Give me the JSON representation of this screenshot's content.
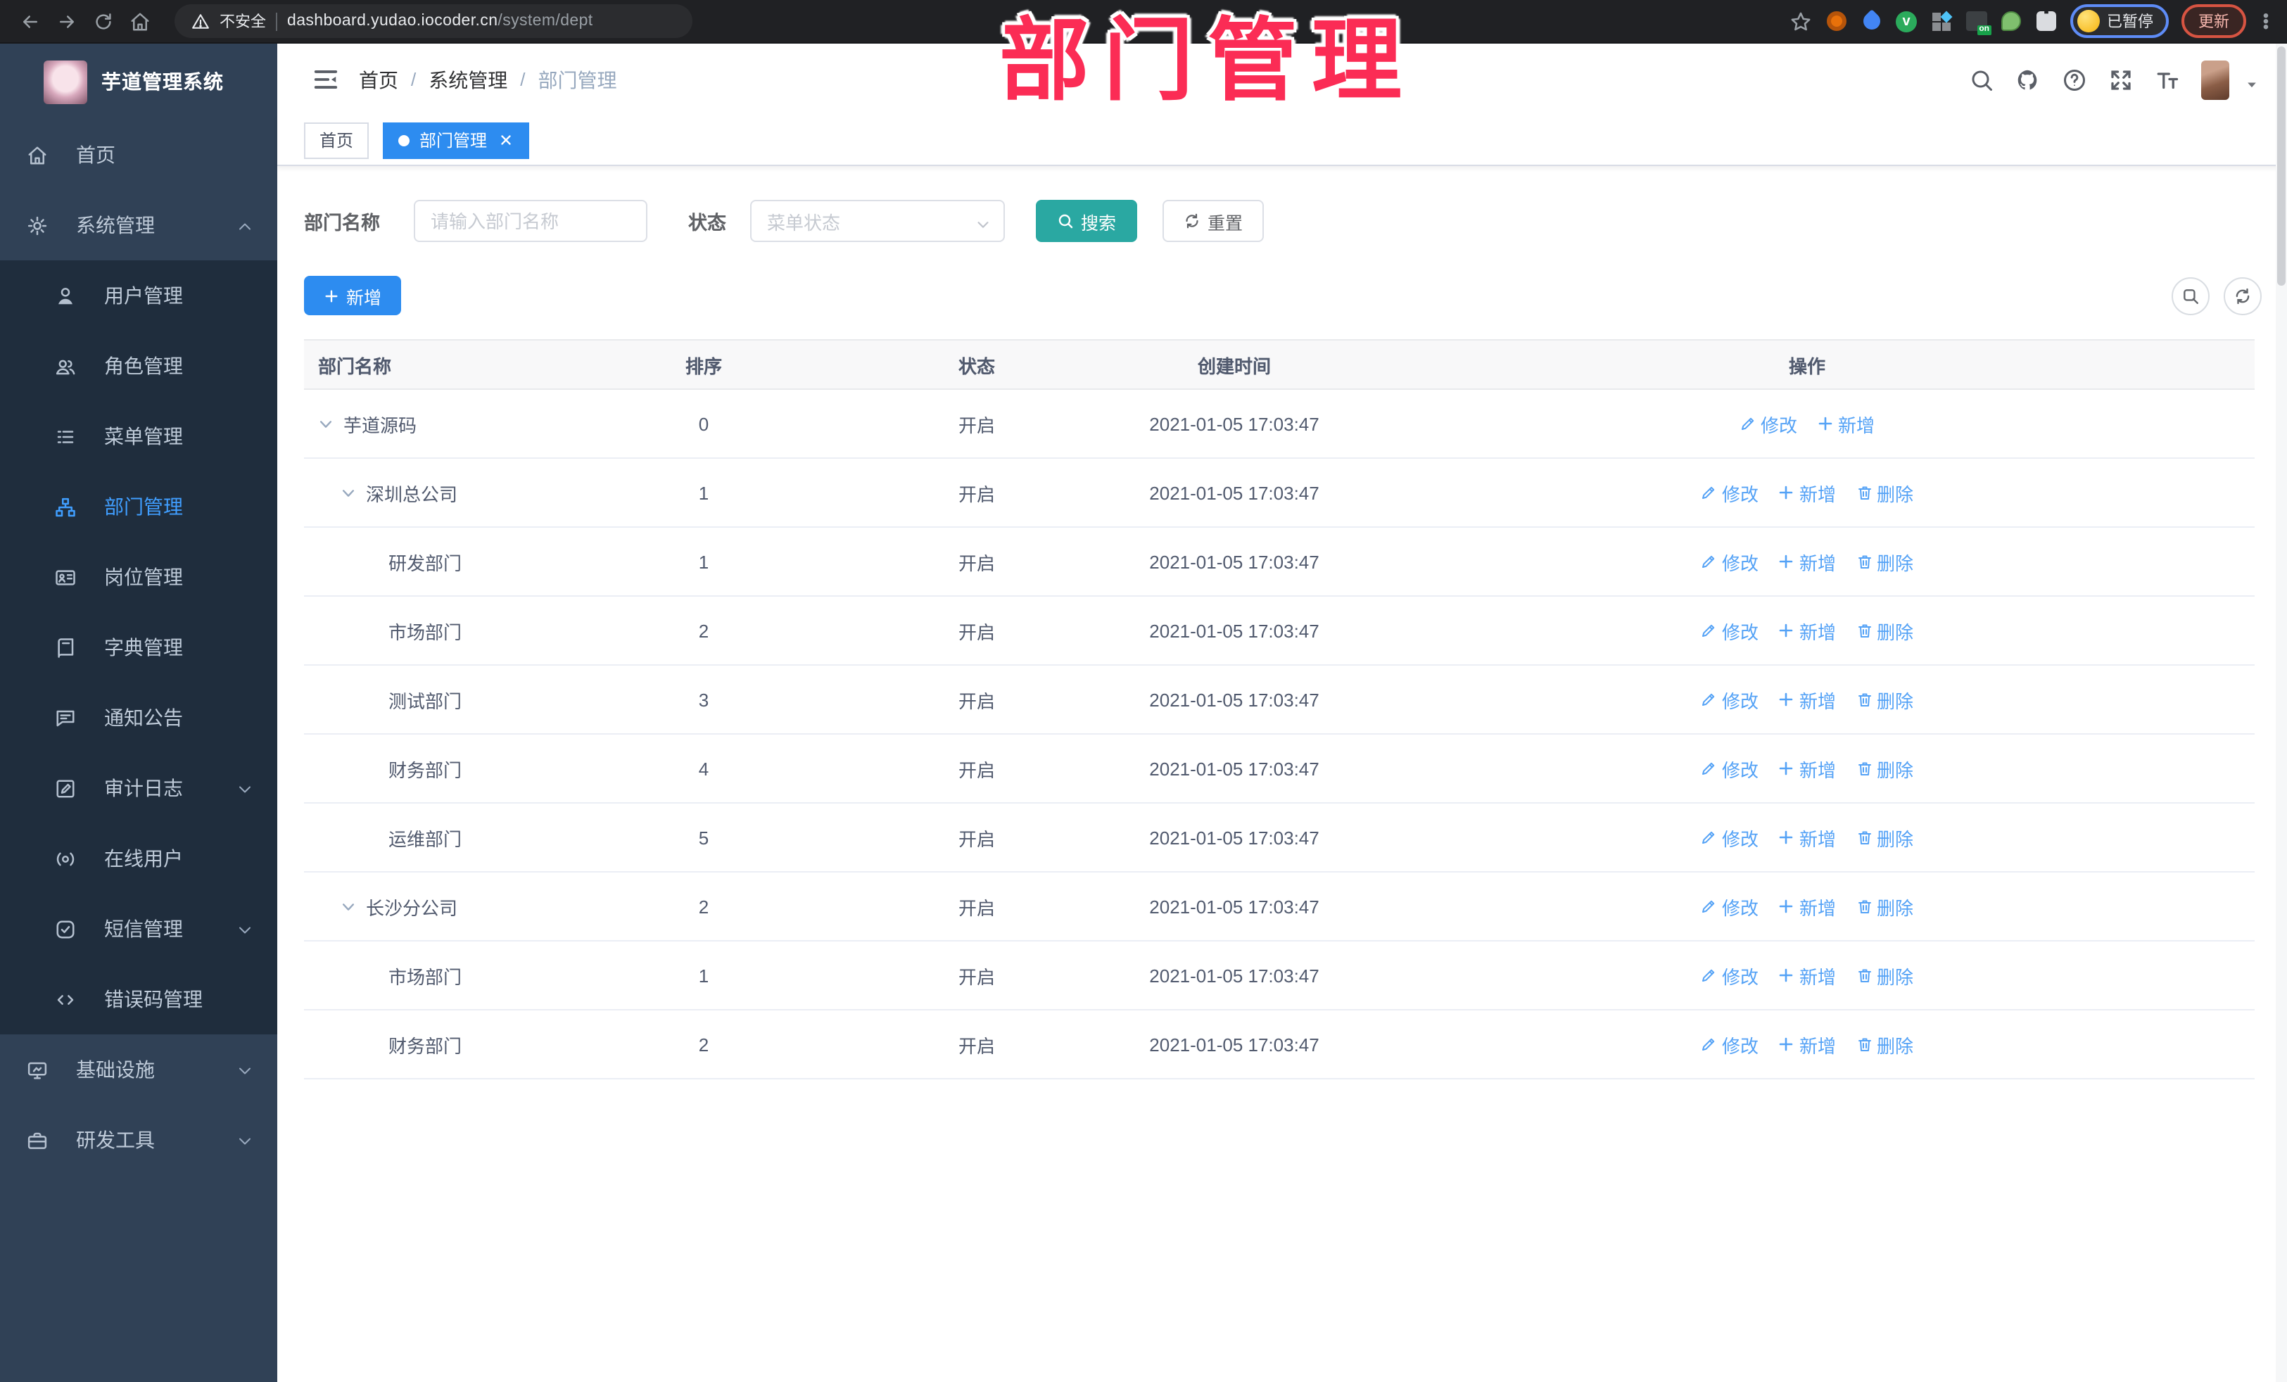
{
  "colors": {
    "accent_blue": "#2d8cf0",
    "sidebar_active_blue": "#409eff",
    "link_blue": "#54a2f6",
    "search_teal": "#2aa8a2",
    "overlay_pink": "#fb2c55",
    "sidebar_bg": "#304156",
    "submenu_bg": "#1f2d3d",
    "chrome_bg": "#202124"
  },
  "browser": {
    "nav_icons": [
      "back-icon",
      "forward-icon",
      "reload-icon",
      "home-icon"
    ],
    "security_label": "不安全",
    "url_host": "dashboard.yudao.iocoder.cn",
    "url_path": "/system/dept",
    "star_icon": "star-icon",
    "extension_icons": [
      "ext-orange-icon",
      "ext-blue-drop-icon",
      "ext-green-check-icon",
      "ext-grid-icon",
      "ext-dark-on-icon",
      "ext-green-leaf-icon",
      "ext-puzzle-icon"
    ],
    "ext_badge": "on",
    "ext_check": "v",
    "profile_badge": "已暂停",
    "update_label": "更新"
  },
  "overlay_title": "部门管理",
  "sidebar": {
    "logo_title": "芋道管理系统",
    "items": [
      {
        "key": "home",
        "label": "首页",
        "icon": "home-icon",
        "level": 1
      },
      {
        "key": "system",
        "label": "系统管理",
        "icon": "gear-icon",
        "level": 1,
        "chevron": "up"
      },
      {
        "key": "user",
        "label": "用户管理",
        "icon": "user-icon",
        "level": 2
      },
      {
        "key": "role",
        "label": "角色管理",
        "icon": "users-icon",
        "level": 2
      },
      {
        "key": "menu",
        "label": "菜单管理",
        "icon": "menu-list-icon",
        "level": 2
      },
      {
        "key": "dept",
        "label": "部门管理",
        "icon": "org-tree-icon",
        "level": 2,
        "active": true
      },
      {
        "key": "post",
        "label": "岗位管理",
        "icon": "id-card-icon",
        "level": 2
      },
      {
        "key": "dict",
        "label": "字典管理",
        "icon": "dictionary-icon",
        "level": 2
      },
      {
        "key": "notice",
        "label": "通知公告",
        "icon": "announcement-icon",
        "level": 2
      },
      {
        "key": "audit",
        "label": "审计日志",
        "icon": "audit-log-icon",
        "level": 2,
        "chevron": "down"
      },
      {
        "key": "online",
        "label": "在线用户",
        "icon": "online-user-icon",
        "level": 2
      },
      {
        "key": "sms",
        "label": "短信管理",
        "icon": "sms-check-icon",
        "level": 2,
        "chevron": "down"
      },
      {
        "key": "errcode",
        "label": "错误码管理",
        "icon": "error-code-icon",
        "level": 2
      },
      {
        "key": "infra",
        "label": "基础设施",
        "icon": "infrastructure-icon",
        "level": 1,
        "chevron": "down"
      },
      {
        "key": "devtools",
        "label": "研发工具",
        "icon": "dev-tools-icon",
        "level": 1,
        "chevron": "down"
      }
    ]
  },
  "header": {
    "breadcrumb": [
      "首页",
      "系统管理",
      "部门管理"
    ],
    "action_icons": [
      "search-icon",
      "github-icon",
      "question-icon",
      "fullscreen-icon",
      "font-size-icon"
    ]
  },
  "tabs": [
    {
      "label": "首页",
      "active": false,
      "closable": false
    },
    {
      "label": "部门管理",
      "active": true,
      "closable": true
    }
  ],
  "filters": {
    "name_label": "部门名称",
    "name_placeholder": "请输入部门名称",
    "name_value": "",
    "status_label": "状态",
    "status_placeholder": "菜单状态",
    "search_label": "搜索",
    "reset_label": "重置"
  },
  "toolbar": {
    "add_label": "新增",
    "mini_icons": [
      "zoom-search-icon",
      "refresh-icon"
    ]
  },
  "table": {
    "columns": [
      "部门名称",
      "排序",
      "状态",
      "创建时间",
      "操作"
    ],
    "action_icon_map": {
      "修改": "edit-icon",
      "新增": "plus-icon",
      "删除": "trash-icon"
    },
    "rows": [
      {
        "name": "芋道源码",
        "level": 0,
        "expandable": true,
        "sort": "0",
        "status": "开启",
        "created": "2021-01-05 17:03:47",
        "actions": [
          "修改",
          "新增"
        ]
      },
      {
        "name": "深圳总公司",
        "level": 1,
        "expandable": true,
        "sort": "1",
        "status": "开启",
        "created": "2021-01-05 17:03:47",
        "actions": [
          "修改",
          "新增",
          "删除"
        ]
      },
      {
        "name": "研发部门",
        "level": 2,
        "expandable": false,
        "sort": "1",
        "status": "开启",
        "created": "2021-01-05 17:03:47",
        "actions": [
          "修改",
          "新增",
          "删除"
        ]
      },
      {
        "name": "市场部门",
        "level": 2,
        "expandable": false,
        "sort": "2",
        "status": "开启",
        "created": "2021-01-05 17:03:47",
        "actions": [
          "修改",
          "新增",
          "删除"
        ]
      },
      {
        "name": "测试部门",
        "level": 2,
        "expandable": false,
        "sort": "3",
        "status": "开启",
        "created": "2021-01-05 17:03:47",
        "actions": [
          "修改",
          "新增",
          "删除"
        ]
      },
      {
        "name": "财务部门",
        "level": 2,
        "expandable": false,
        "sort": "4",
        "status": "开启",
        "created": "2021-01-05 17:03:47",
        "actions": [
          "修改",
          "新增",
          "删除"
        ]
      },
      {
        "name": "运维部门",
        "level": 2,
        "expandable": false,
        "sort": "5",
        "status": "开启",
        "created": "2021-01-05 17:03:47",
        "actions": [
          "修改",
          "新增",
          "删除"
        ]
      },
      {
        "name": "长沙分公司",
        "level": 1,
        "expandable": true,
        "sort": "2",
        "status": "开启",
        "created": "2021-01-05 17:03:47",
        "actions": [
          "修改",
          "新增",
          "删除"
        ]
      },
      {
        "name": "市场部门",
        "level": 2,
        "expandable": false,
        "sort": "1",
        "status": "开启",
        "created": "2021-01-05 17:03:47",
        "actions": [
          "修改",
          "新增",
          "删除"
        ]
      },
      {
        "name": "财务部门",
        "level": 2,
        "expandable": false,
        "sort": "2",
        "status": "开启",
        "created": "2021-01-05 17:03:47",
        "actions": [
          "修改",
          "新增",
          "删除"
        ]
      }
    ]
  }
}
